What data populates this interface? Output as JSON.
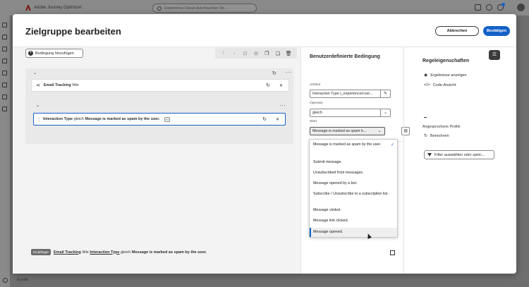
{
  "app": {
    "name": "Adobe Journey Optimizer",
    "search_placeholder": "Experience Cloud durchsuchen Str..."
  },
  "bottom": {
    "label": "Kunde"
  },
  "modal": {
    "title": "Zielgruppe bearbeiten",
    "cancel_label": "Abbrechen",
    "confirm_label": "Bestätigen"
  },
  "canvas": {
    "add_condition_label": "Bedingung hinzufügen",
    "card1": {
      "field": "Email Tracking",
      "suffix": "Wie"
    },
    "card2": {
      "field": "Interaction Type",
      "operator": "gleich",
      "value": "Message is marked as spam by the user."
    }
  },
  "summary": {
    "badge": "Empfänger",
    "link1": "Email Tracking",
    "w1": "Wie",
    "link2": "Interaction Type",
    "w2": "gleich",
    "value": "Message is marked as spam by the user."
  },
  "condition_panel": {
    "title": "Benutzerdefinierte Bedingung",
    "attribute_label": "Attribut",
    "attribute_value": "Interaction Type (_experience/cust...",
    "operator_label": "Operator",
    "operator_value": "gleich",
    "value_label": "Wert",
    "value_value": "Message is marked as spam b..."
  },
  "dropdown": {
    "options": [
      "Message is marked as spam by the user.",
      "Submit message.",
      "Unsubscribed from messages.",
      "Message opened by a bot.",
      "Subscribe / Unsubscribe to a subscription list.",
      "Message visited.",
      "Message link clicked.",
      "Message opened."
    ],
    "selected_index": 0,
    "hovered_index": 7
  },
  "rules_panel": {
    "title": "Regeleigenschaften",
    "show_results": "Ergebnisse anzeigen",
    "code_view": "Code-Ansicht",
    "estimated_profiles_label": "Angesprochene Profile",
    "calculate": "Berechnen",
    "filter_placeholder": "Filter auswählen oder speic..."
  },
  "colors": {
    "accent": "#1461c8"
  }
}
